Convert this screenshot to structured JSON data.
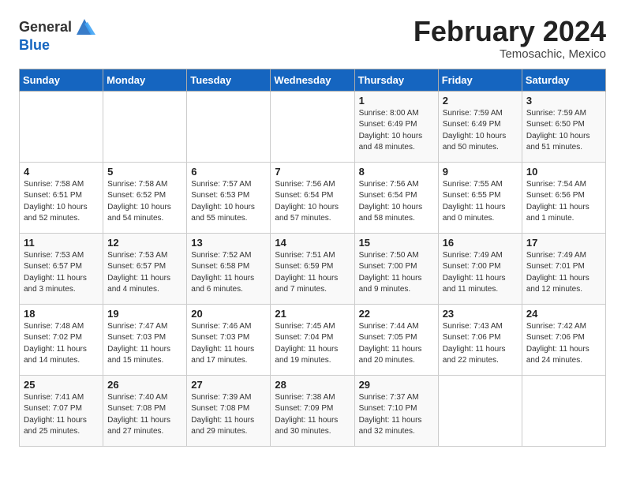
{
  "header": {
    "logo_general": "General",
    "logo_blue": "Blue",
    "month_year": "February 2024",
    "location": "Temosachic, Mexico"
  },
  "days_of_week": [
    "Sunday",
    "Monday",
    "Tuesday",
    "Wednesday",
    "Thursday",
    "Friday",
    "Saturday"
  ],
  "weeks": [
    [
      {
        "day": "",
        "info": ""
      },
      {
        "day": "",
        "info": ""
      },
      {
        "day": "",
        "info": ""
      },
      {
        "day": "",
        "info": ""
      },
      {
        "day": "1",
        "info": "Sunrise: 8:00 AM\nSunset: 6:49 PM\nDaylight: 10 hours\nand 48 minutes."
      },
      {
        "day": "2",
        "info": "Sunrise: 7:59 AM\nSunset: 6:49 PM\nDaylight: 10 hours\nand 50 minutes."
      },
      {
        "day": "3",
        "info": "Sunrise: 7:59 AM\nSunset: 6:50 PM\nDaylight: 10 hours\nand 51 minutes."
      }
    ],
    [
      {
        "day": "4",
        "info": "Sunrise: 7:58 AM\nSunset: 6:51 PM\nDaylight: 10 hours\nand 52 minutes."
      },
      {
        "day": "5",
        "info": "Sunrise: 7:58 AM\nSunset: 6:52 PM\nDaylight: 10 hours\nand 54 minutes."
      },
      {
        "day": "6",
        "info": "Sunrise: 7:57 AM\nSunset: 6:53 PM\nDaylight: 10 hours\nand 55 minutes."
      },
      {
        "day": "7",
        "info": "Sunrise: 7:56 AM\nSunset: 6:54 PM\nDaylight: 10 hours\nand 57 minutes."
      },
      {
        "day": "8",
        "info": "Sunrise: 7:56 AM\nSunset: 6:54 PM\nDaylight: 10 hours\nand 58 minutes."
      },
      {
        "day": "9",
        "info": "Sunrise: 7:55 AM\nSunset: 6:55 PM\nDaylight: 11 hours\nand 0 minutes."
      },
      {
        "day": "10",
        "info": "Sunrise: 7:54 AM\nSunset: 6:56 PM\nDaylight: 11 hours\nand 1 minute."
      }
    ],
    [
      {
        "day": "11",
        "info": "Sunrise: 7:53 AM\nSunset: 6:57 PM\nDaylight: 11 hours\nand 3 minutes."
      },
      {
        "day": "12",
        "info": "Sunrise: 7:53 AM\nSunset: 6:57 PM\nDaylight: 11 hours\nand 4 minutes."
      },
      {
        "day": "13",
        "info": "Sunrise: 7:52 AM\nSunset: 6:58 PM\nDaylight: 11 hours\nand 6 minutes."
      },
      {
        "day": "14",
        "info": "Sunrise: 7:51 AM\nSunset: 6:59 PM\nDaylight: 11 hours\nand 7 minutes."
      },
      {
        "day": "15",
        "info": "Sunrise: 7:50 AM\nSunset: 7:00 PM\nDaylight: 11 hours\nand 9 minutes."
      },
      {
        "day": "16",
        "info": "Sunrise: 7:49 AM\nSunset: 7:00 PM\nDaylight: 11 hours\nand 11 minutes."
      },
      {
        "day": "17",
        "info": "Sunrise: 7:49 AM\nSunset: 7:01 PM\nDaylight: 11 hours\nand 12 minutes."
      }
    ],
    [
      {
        "day": "18",
        "info": "Sunrise: 7:48 AM\nSunset: 7:02 PM\nDaylight: 11 hours\nand 14 minutes."
      },
      {
        "day": "19",
        "info": "Sunrise: 7:47 AM\nSunset: 7:03 PM\nDaylight: 11 hours\nand 15 minutes."
      },
      {
        "day": "20",
        "info": "Sunrise: 7:46 AM\nSunset: 7:03 PM\nDaylight: 11 hours\nand 17 minutes."
      },
      {
        "day": "21",
        "info": "Sunrise: 7:45 AM\nSunset: 7:04 PM\nDaylight: 11 hours\nand 19 minutes."
      },
      {
        "day": "22",
        "info": "Sunrise: 7:44 AM\nSunset: 7:05 PM\nDaylight: 11 hours\nand 20 minutes."
      },
      {
        "day": "23",
        "info": "Sunrise: 7:43 AM\nSunset: 7:06 PM\nDaylight: 11 hours\nand 22 minutes."
      },
      {
        "day": "24",
        "info": "Sunrise: 7:42 AM\nSunset: 7:06 PM\nDaylight: 11 hours\nand 24 minutes."
      }
    ],
    [
      {
        "day": "25",
        "info": "Sunrise: 7:41 AM\nSunset: 7:07 PM\nDaylight: 11 hours\nand 25 minutes."
      },
      {
        "day": "26",
        "info": "Sunrise: 7:40 AM\nSunset: 7:08 PM\nDaylight: 11 hours\nand 27 minutes."
      },
      {
        "day": "27",
        "info": "Sunrise: 7:39 AM\nSunset: 7:08 PM\nDaylight: 11 hours\nand 29 minutes."
      },
      {
        "day": "28",
        "info": "Sunrise: 7:38 AM\nSunset: 7:09 PM\nDaylight: 11 hours\nand 30 minutes."
      },
      {
        "day": "29",
        "info": "Sunrise: 7:37 AM\nSunset: 7:10 PM\nDaylight: 11 hours\nand 32 minutes."
      },
      {
        "day": "",
        "info": ""
      },
      {
        "day": "",
        "info": ""
      }
    ]
  ]
}
